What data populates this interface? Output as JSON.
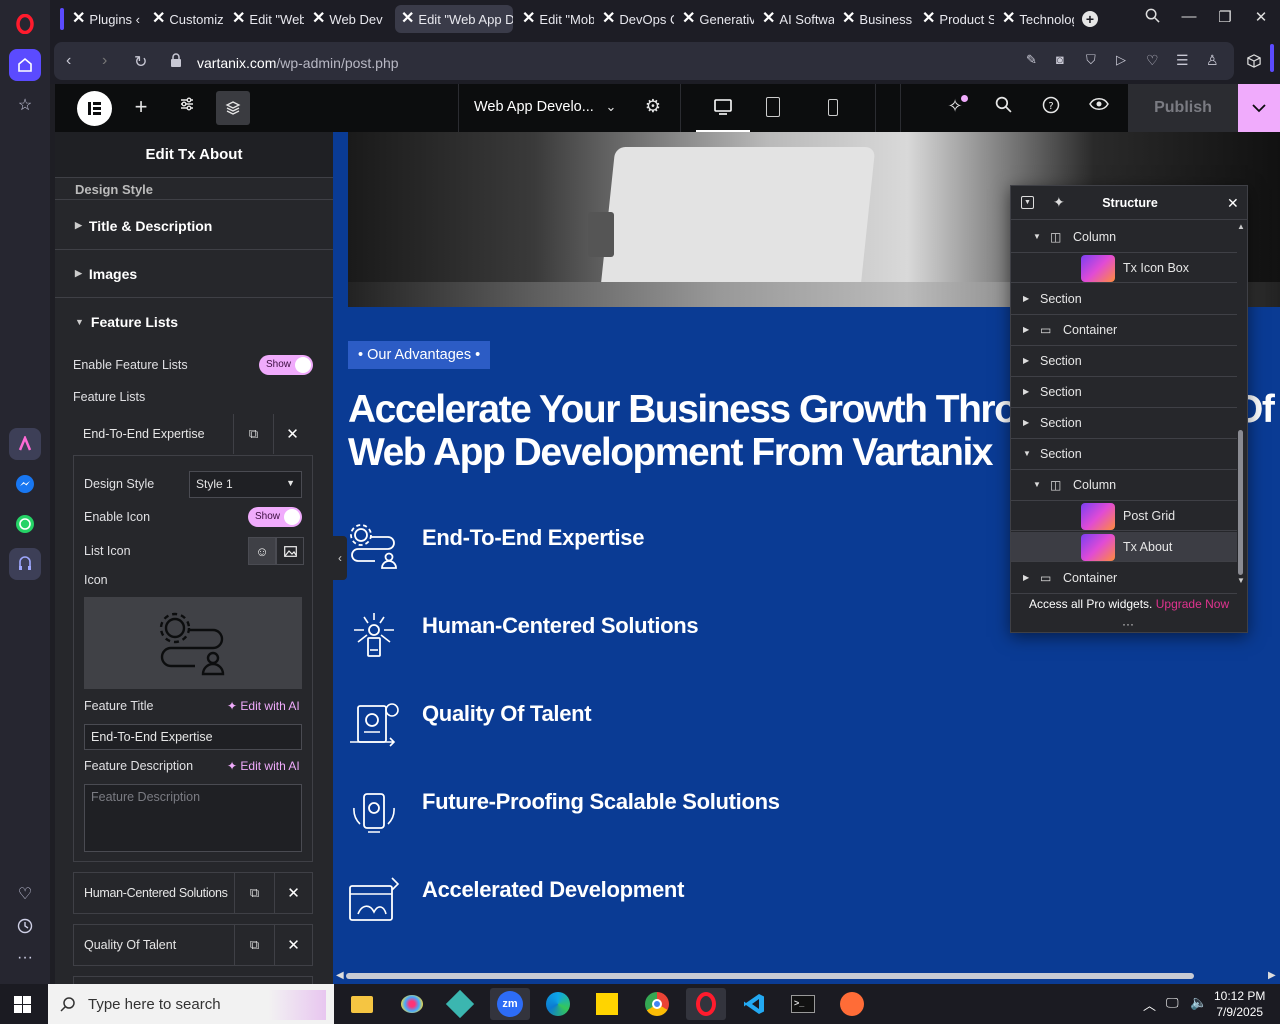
{
  "browser": {
    "tabs": [
      {
        "label": "Plugins ‹",
        "active": false
      },
      {
        "label": "Customiz",
        "active": false
      },
      {
        "label": "Edit \"Web",
        "active": false
      },
      {
        "label": "Web Dev",
        "active": false
      },
      {
        "label": "Edit \"Web App D",
        "active": true
      },
      {
        "label": "Edit \"Mob",
        "active": false
      },
      {
        "label": "DevOps C",
        "active": false
      },
      {
        "label": "Generativ",
        "active": false
      },
      {
        "label": "AI Softwa",
        "active": false
      },
      {
        "label": "Business",
        "active": false
      },
      {
        "label": "Product S",
        "active": false
      },
      {
        "label": "Technolog",
        "active": false
      }
    ],
    "url_host": "vartanix.com",
    "url_path": "/wp-admin/post.php"
  },
  "elementor": {
    "page_title": "Web App Develo...",
    "publish_label": "Publish"
  },
  "panel": {
    "title": "Edit Tx About",
    "partial_section": "Design Style",
    "sections": [
      "Title & Description",
      "Images",
      "Feature Lists"
    ],
    "enable_feature_lists_label": "Enable Feature Lists",
    "toggle_show": "Show",
    "feature_lists_label": "Feature Lists",
    "open_item": {
      "title": "End-To-End Expertise",
      "design_style_label": "Design Style",
      "design_style_value": "Style 1",
      "enable_icon_label": "Enable Icon",
      "list_icon_label": "List Icon",
      "icon_label": "Icon",
      "feature_title_label": "Feature Title",
      "edit_with_ai": "Edit with AI",
      "feature_title_value": "End-To-End Expertise",
      "feature_description_label": "Feature Description",
      "feature_description_placeholder": "Feature Description"
    },
    "other_items": [
      "Human-Centered Solutions",
      "Quality Of Talent"
    ]
  },
  "canvas": {
    "badge": "• Our Advantages •",
    "headline_line1": "Accelerate Your Business Growth Through",
    "headline_line1_right": "Of",
    "headline_line2": "Web App Development From Vartanix",
    "features": [
      {
        "title": "End-To-End Expertise",
        "icon": "gear-person-icon"
      },
      {
        "title": "Human-Centered Solutions",
        "icon": "people-network-icon"
      },
      {
        "title": "Quality Of Talent",
        "icon": "quality-clipboard-icon"
      },
      {
        "title": "Future-Proofing Scalable Solutions",
        "icon": "scalable-phone-icon"
      },
      {
        "title": "Accelerated Development",
        "icon": "browser-rocket-icon"
      }
    ]
  },
  "navigator": {
    "title": "Structure",
    "rows": [
      {
        "label": "Column",
        "type": "column",
        "depth": 1,
        "caret": "down"
      },
      {
        "label": "Tx Icon Box",
        "type": "widget",
        "depth": 2,
        "caret": "none"
      },
      {
        "label": "Section",
        "type": "section",
        "depth": 0,
        "caret": "right"
      },
      {
        "label": "Container",
        "type": "container",
        "depth": 0,
        "caret": "right"
      },
      {
        "label": "Section",
        "type": "section",
        "depth": 0,
        "caret": "right"
      },
      {
        "label": "Section",
        "type": "section",
        "depth": 0,
        "caret": "right"
      },
      {
        "label": "Section",
        "type": "section",
        "depth": 0,
        "caret": "right"
      },
      {
        "label": "Section",
        "type": "section",
        "depth": 0,
        "caret": "down"
      },
      {
        "label": "Column",
        "type": "column",
        "depth": 1,
        "caret": "down"
      },
      {
        "label": "Post Grid",
        "type": "widget",
        "depth": 2,
        "caret": "none"
      },
      {
        "label": "Tx About",
        "type": "widget",
        "depth": 2,
        "caret": "none",
        "selected": true
      },
      {
        "label": "Container",
        "type": "container",
        "depth": 0,
        "caret": "right"
      }
    ],
    "promo_text": "Access all Pro widgets.",
    "promo_link": "Upgrade Now"
  },
  "taskbar": {
    "search_placeholder": "Type here to search",
    "time": "10:12 PM",
    "date": "7/9/2025"
  },
  "colors": {
    "accent_pink": "#f0abfc",
    "canvas_blue": "#0a3b94",
    "upgrade_link": "#e0338f"
  }
}
